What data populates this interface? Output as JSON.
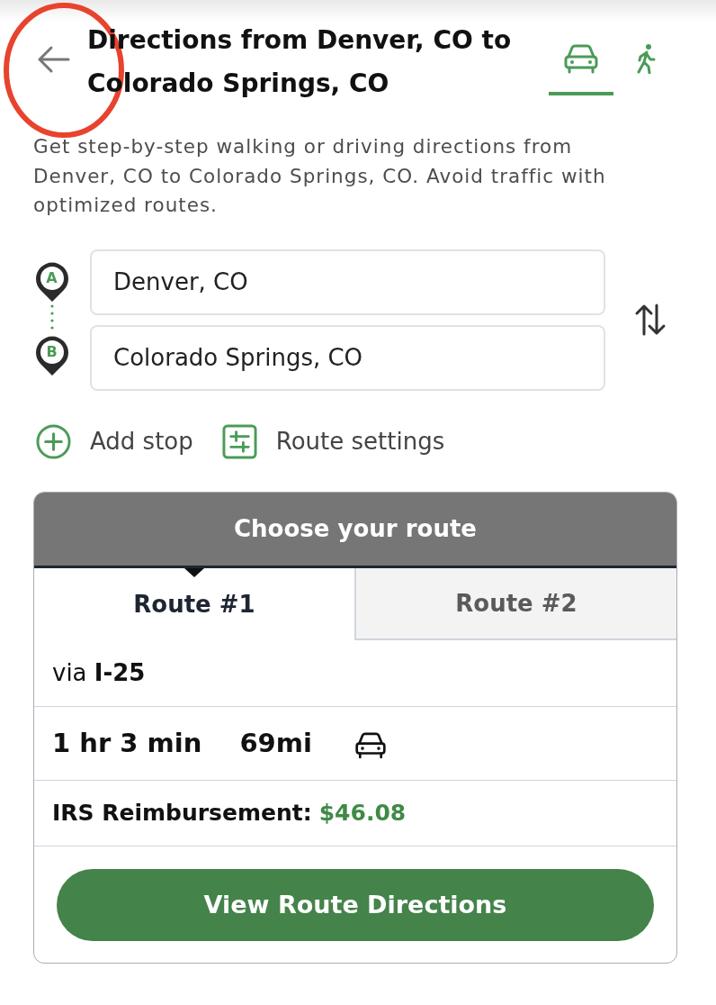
{
  "header": {
    "back_button": {
      "highlighted": true
    },
    "title": "Directions from Denver, CO to Colorado Springs, CO",
    "modes": [
      {
        "kind": "car",
        "selected": true
      },
      {
        "kind": "walk",
        "selected": false
      }
    ]
  },
  "description": "Get step-by-step walking or driving directions from Denver, CO to Colorado Springs, CO. Avoid traffic with optimized routes.",
  "stops": [
    {
      "marker": "A",
      "value": "Denver, CO"
    },
    {
      "marker": "B",
      "value": "Colorado Springs, CO"
    }
  ],
  "actions": [
    {
      "kind": "add",
      "label": "Add stop"
    },
    {
      "kind": "settings",
      "label": "Route settings"
    }
  ],
  "route_card": {
    "title": "Choose your route",
    "tabs": [
      {
        "label": "Route #1",
        "selected": true
      },
      {
        "label": "Route #2",
        "selected": false
      }
    ],
    "via": "via **I-25**",
    "trip": {
      "duration": "1 hr 3 min",
      "distance": "69mi",
      "kind": "car"
    },
    "reimbursement": {
      "label": "IRS Reimbursement:",
      "amount": "$46.08"
    },
    "button": "View Route Directions"
  }
}
